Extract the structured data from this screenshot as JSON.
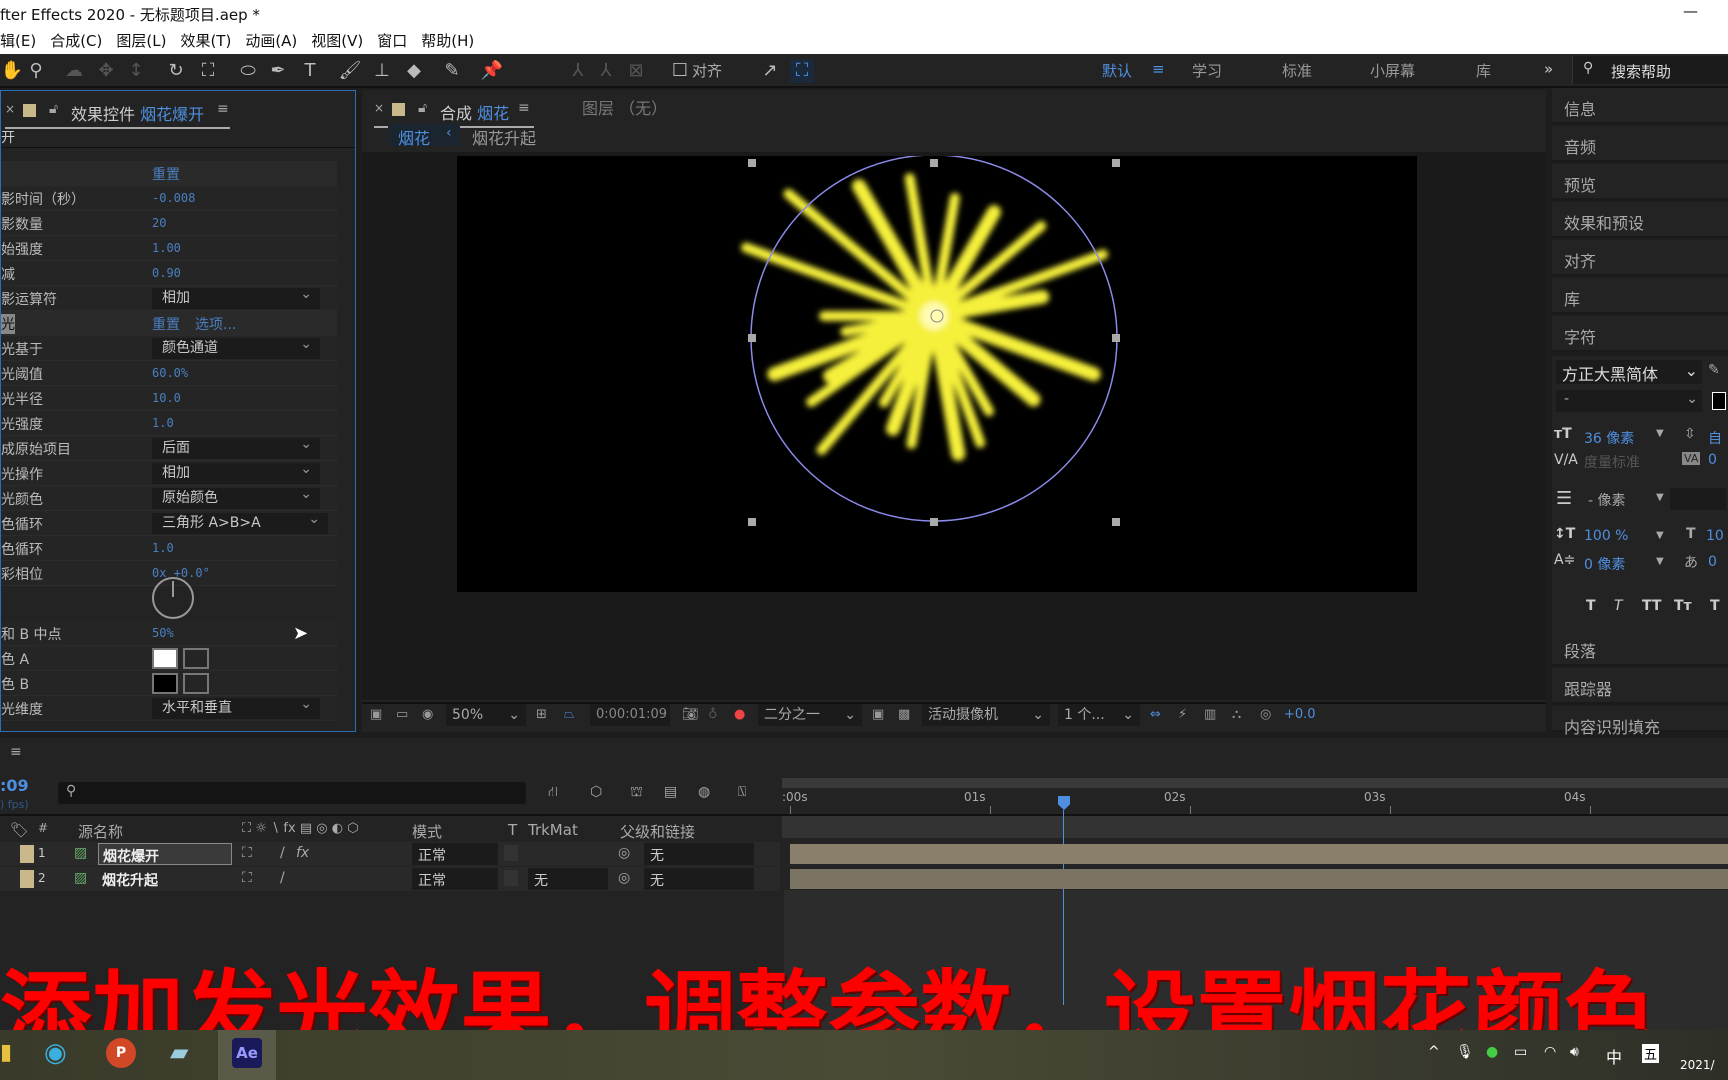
{
  "window": {
    "title": "fter Effects 2020 - 无标题项目.aep *",
    "minimize": "—"
  },
  "menu": [
    "辑(E)",
    "合成(C)",
    "图层(L)",
    "效果(T)",
    "动画(A)",
    "视图(V)",
    "窗口",
    "帮助(H)"
  ],
  "toolbar": {
    "snap_label": "对齐",
    "workspaces": [
      "默认",
      "学习",
      "标准",
      "小屏幕",
      "库"
    ],
    "active_workspace": "默认",
    "more": "»",
    "search_placeholder": "搜索帮助"
  },
  "effects_panel": {
    "tab_prefix": "效果控件",
    "tab_layer": "烟花爆开",
    "layer_label": "开",
    "rows": [
      {
        "label": "",
        "value": "重置",
        "type": "header"
      },
      {
        "label": "影时间（秒）",
        "value": "-0.008",
        "type": "value"
      },
      {
        "label": "影数量",
        "value": "20",
        "type": "value"
      },
      {
        "label": "始强度",
        "value": "1.00",
        "type": "value"
      },
      {
        "label": "减",
        "value": "0.90",
        "type": "value"
      },
      {
        "label": "影运算符",
        "value": "相加",
        "type": "dropdown"
      },
      {
        "label": "光",
        "value": "重置",
        "extra": "选项...",
        "type": "header"
      },
      {
        "label": "光基于",
        "value": "颜色通道",
        "type": "dropdown"
      },
      {
        "label": "光阈值",
        "value": "60.0%",
        "type": "value"
      },
      {
        "label": "光半径",
        "value": "10.0",
        "type": "value"
      },
      {
        "label": "光强度",
        "value": "1.0",
        "type": "value"
      },
      {
        "label": "成原始项目",
        "value": "后面",
        "type": "dropdown"
      },
      {
        "label": "光操作",
        "value": "相加",
        "type": "dropdown"
      },
      {
        "label": "光颜色",
        "value": "原始颜色",
        "type": "dropdown"
      },
      {
        "label": "色循环",
        "value": "三角形 A>B>A",
        "type": "dropdown"
      },
      {
        "label": "色循环",
        "value": "1.0",
        "type": "value"
      },
      {
        "label": "彩相位",
        "value": "0x +0.0°",
        "type": "value"
      }
    ],
    "rows2": [
      {
        "label": "和 B 中点",
        "value": "50%",
        "type": "value"
      },
      {
        "label": "色 A",
        "color": "#ffffff",
        "type": "swatch"
      },
      {
        "label": "色 B",
        "color": "#000000",
        "type": "swatch"
      },
      {
        "label": "光维度",
        "value": "水平和垂直",
        "type": "dropdown"
      }
    ]
  },
  "comp_panel": {
    "tab_prefix": "合成",
    "tab_comp": "烟花",
    "layer_tab": "图层 （无）",
    "breadcrumb": [
      "烟花",
      "烟花升起"
    ],
    "viewer": {
      "zoom": "50%",
      "timecode": "0:00:01:09",
      "resolution": "二分之一",
      "camera": "活动摄像机",
      "views": "1 个...",
      "exposure": "+0.0"
    }
  },
  "right_panels": [
    "信息",
    "音频",
    "预览",
    "效果和预设",
    "对齐",
    "库",
    "字符"
  ],
  "right_panels_bottom": [
    "段落",
    "跟踪器",
    "内容识别填充"
  ],
  "character": {
    "font": "方正大黑简体",
    "style": "-",
    "size": "36 像素",
    "leading": "自",
    "kerning": "度量标准",
    "tracking": "0",
    "stroke": "- 像素",
    "vscale": "100 %",
    "hscale": "10",
    "baseline": "0 像素",
    "tsume": "0",
    "styles": [
      "T",
      "T",
      "TT",
      "Tт",
      "T"
    ]
  },
  "timeline": {
    "timecode": ":09",
    "fps": ") fps)",
    "search_placeholder": "",
    "columns": {
      "num": "#",
      "name": "源名称",
      "mode": "模式",
      "t": "T",
      "trkmat": "TrkMat",
      "parent": "父级和链接"
    },
    "layers": [
      {
        "num": "1",
        "name": "烟花爆开",
        "mode": "正常",
        "trkmat": "",
        "parent": "无"
      },
      {
        "num": "2",
        "name": "烟花升起",
        "mode": "正常",
        "trkmat": "无",
        "parent": "无"
      }
    ],
    "ruler": [
      ":00s",
      "01s",
      "02s",
      "03s",
      "04s"
    ]
  },
  "caption": "添加发光效果，调整参数，设置烟花颜色",
  "taskbar": {
    "ime": "中",
    "ime2": "五",
    "date": "2021/"
  },
  "colors": {
    "accent": "#4f8fe0",
    "caption": "#ff0000",
    "firework": "#f5f03a",
    "layer_label": "#c8b88a"
  }
}
